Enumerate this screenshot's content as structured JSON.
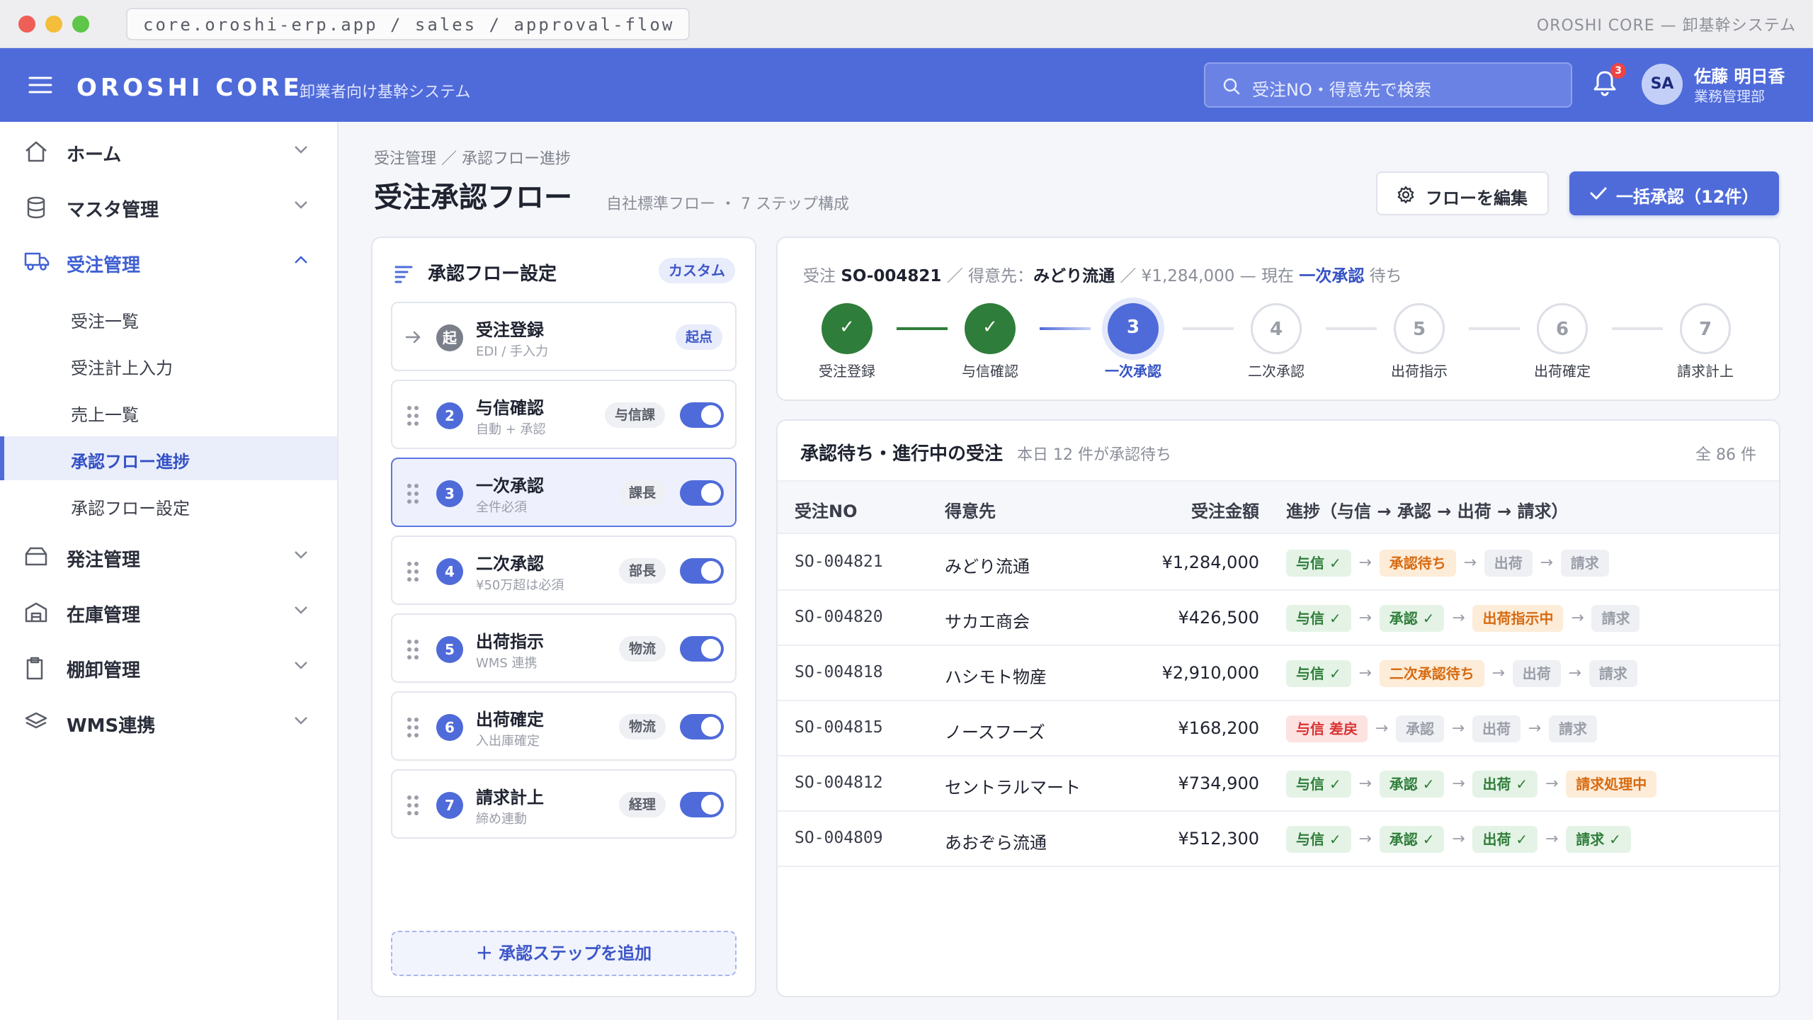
{
  "window": {
    "url": "core.oroshi-erp.app / sales / approval-flow",
    "title": "OROSHI CORE — 卸基幹システム"
  },
  "appbar": {
    "brand": "OROSHI CORE",
    "tagline": "卸業者向け基幹システム",
    "search_placeholder": "受注NO・得意先で検索",
    "notification_count": "3",
    "user": {
      "initials": "SA",
      "name": "佐藤 明日香",
      "dept": "業務管理部"
    }
  },
  "sidebar": {
    "items": [
      {
        "label": "ホーム",
        "icon": "home-icon"
      },
      {
        "label": "マスタ管理",
        "icon": "database-icon"
      },
      {
        "label": "受注管理",
        "icon": "truck-icon"
      },
      {
        "label": "発注管理",
        "icon": "box-icon"
      },
      {
        "label": "在庫管理",
        "icon": "warehouse-icon"
      },
      {
        "label": "棚卸管理",
        "icon": "clipboard-icon"
      },
      {
        "label": "WMS連携",
        "icon": "layers-icon"
      }
    ],
    "sub_items": [
      {
        "label": "受注一覧"
      },
      {
        "label": "受注計上入力"
      },
      {
        "label": "売上一覧"
      },
      {
        "label": "承認フロー進捗"
      },
      {
        "label": "承認フロー設定"
      }
    ]
  },
  "page": {
    "breadcrumb": "受注管理 ／ 承認フロー進捗",
    "title": "受注承認フロー",
    "subtitle": "自社標準フロー ・ 7 ステップ構成",
    "edit_button": "フローを編集",
    "bulk_button": "一括承認（12件）"
  },
  "flow_settings": {
    "title": "承認フロー設定",
    "tag": "カスタム",
    "start": {
      "icon_label": "起",
      "name": "受注登録",
      "desc": "EDI / 手入力",
      "role": "起点"
    },
    "steps": [
      {
        "num": "2",
        "name": "与信確認",
        "desc": "自動 + 承認",
        "role": "与信課",
        "enabled": true
      },
      {
        "num": "3",
        "name": "一次承認",
        "desc": "全件必須",
        "role": "課長",
        "enabled": true
      },
      {
        "num": "4",
        "name": "二次承認",
        "desc": "¥50万超は必須",
        "role": "部長",
        "enabled": true
      },
      {
        "num": "5",
        "name": "出荷指示",
        "desc": "WMS 連携",
        "role": "物流",
        "enabled": true
      },
      {
        "num": "6",
        "name": "出荷確定",
        "desc": "入出庫確定",
        "role": "物流",
        "enabled": true
      },
      {
        "num": "7",
        "name": "請求計上",
        "desc": "締め連動",
        "role": "経理",
        "enabled": true
      }
    ],
    "add_label": "承認ステップを追加"
  },
  "progress": {
    "order_label": "受注",
    "order_no": "SO-004821",
    "sep1": "／ 得意先：",
    "customer": "みどり流通",
    "amount_text": "／ ¥1,284,000 — 現在",
    "current": "一次承認",
    "suffix": "待ち",
    "nodes": [
      {
        "mark": "✓",
        "label": "受注登録",
        "state": "done"
      },
      {
        "mark": "✓",
        "label": "与信確認",
        "state": "done"
      },
      {
        "mark": "3",
        "label": "一次承認",
        "state": "current"
      },
      {
        "mark": "4",
        "label": "二次承認",
        "state": "todo"
      },
      {
        "mark": "5",
        "label": "出荷指示",
        "state": "todo"
      },
      {
        "mark": "6",
        "label": "出荷確定",
        "state": "todo"
      },
      {
        "mark": "7",
        "label": "請求計上",
        "state": "todo"
      }
    ]
  },
  "orders": {
    "title": "承認待ち・進行中の受注",
    "subtitle": "本日 12 件が承認待ち",
    "total": "全 86 件",
    "columns": {
      "no": "受注NO",
      "customer": "得意先",
      "amount": "受注金額",
      "progress": "進捗（与信 → 承認 → 出荷 → 請求）"
    },
    "rows": [
      {
        "no": "SO-004821",
        "customer": "みどり流通",
        "amount": "¥1,284,000",
        "chips": [
          {
            "label": "与信 ✓",
            "state": "ok"
          },
          {
            "label": "承認待ち",
            "state": "wait"
          },
          {
            "label": "出荷",
            "state": "pend"
          },
          {
            "label": "請求",
            "state": "pend"
          }
        ]
      },
      {
        "no": "SO-004820",
        "customer": "サカエ商会",
        "amount": "¥426,500",
        "chips": [
          {
            "label": "与信 ✓",
            "state": "ok"
          },
          {
            "label": "承認 ✓",
            "state": "ok"
          },
          {
            "label": "出荷指示中",
            "state": "wait"
          },
          {
            "label": "請求",
            "state": "pend"
          }
        ]
      },
      {
        "no": "SO-004818",
        "customer": "ハシモト物産",
        "amount": "¥2,910,000",
        "chips": [
          {
            "label": "与信 ✓",
            "state": "ok"
          },
          {
            "label": "二次承認待ち",
            "state": "wait"
          },
          {
            "label": "出荷",
            "state": "pend"
          },
          {
            "label": "請求",
            "state": "pend"
          }
        ]
      },
      {
        "no": "SO-004815",
        "customer": "ノースフーズ",
        "amount": "¥168,200",
        "chips": [
          {
            "label": "与信 差戻",
            "state": "ng"
          },
          {
            "label": "承認",
            "state": "pend"
          },
          {
            "label": "出荷",
            "state": "pend"
          },
          {
            "label": "請求",
            "state": "pend"
          }
        ]
      },
      {
        "no": "SO-004812",
        "customer": "セントラルマート",
        "amount": "¥734,900",
        "chips": [
          {
            "label": "与信 ✓",
            "state": "ok"
          },
          {
            "label": "承認 ✓",
            "state": "ok"
          },
          {
            "label": "出荷 ✓",
            "state": "ok"
          },
          {
            "label": "請求処理中",
            "state": "wait"
          }
        ]
      },
      {
        "no": "SO-004809",
        "customer": "あおぞら流通",
        "amount": "¥512,300",
        "chips": [
          {
            "label": "与信 ✓",
            "state": "ok"
          },
          {
            "label": "承認 ✓",
            "state": "ok"
          },
          {
            "label": "出荷 ✓",
            "state": "ok"
          },
          {
            "label": "請求 ✓",
            "state": "ok"
          }
        ]
      }
    ]
  },
  "colors": {
    "accent": "#4f6bd9",
    "done": "#2f7d3a",
    "warning": "#d76a10",
    "danger": "#d83232"
  }
}
